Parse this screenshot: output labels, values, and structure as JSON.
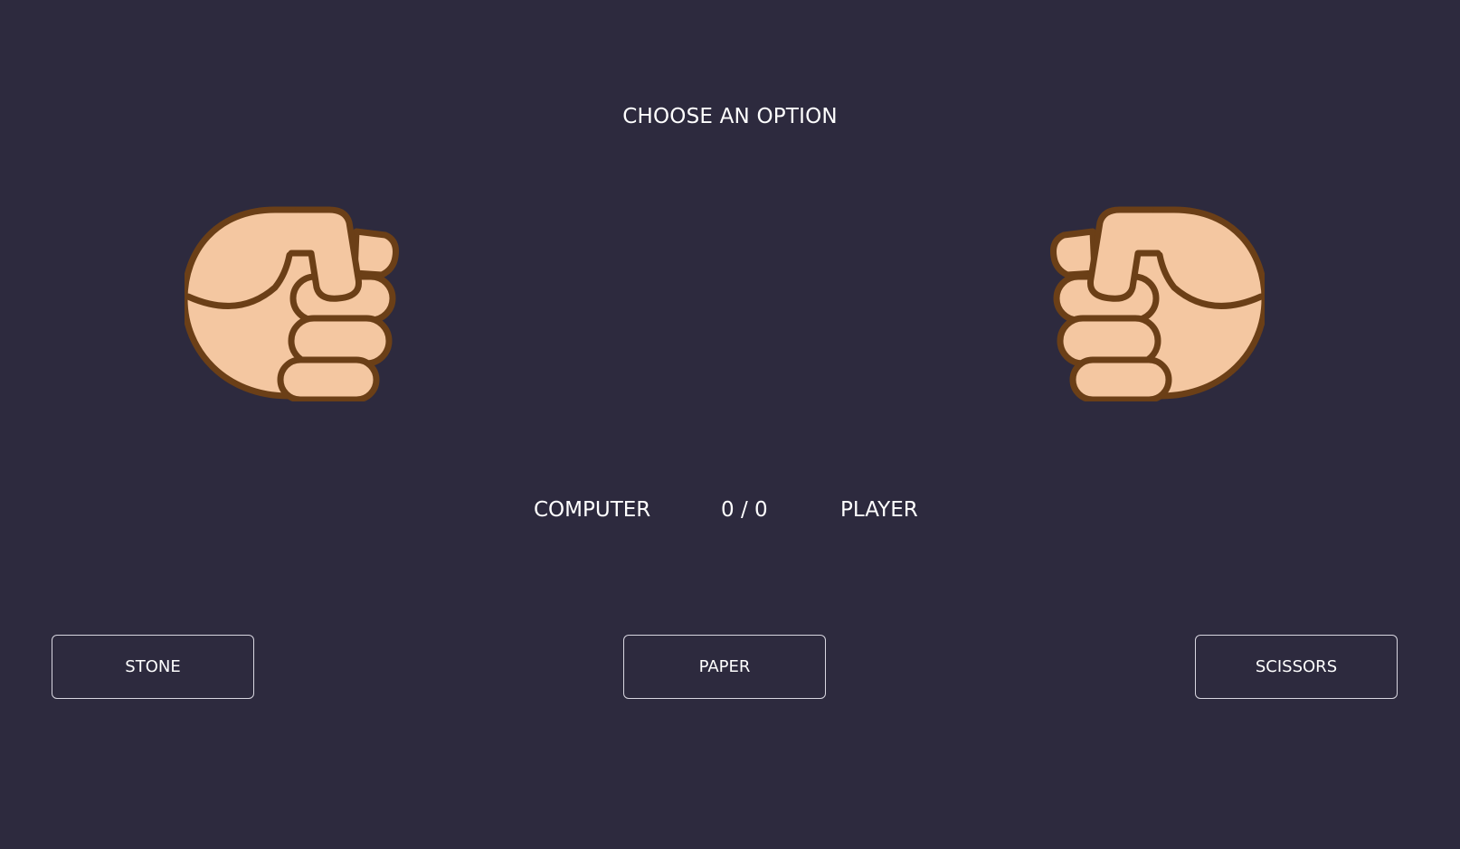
{
  "prompt": "CHOOSE AN OPTION",
  "hands": {
    "computer": {
      "icon": "fist-icon"
    },
    "player": {
      "icon": "fist-icon"
    }
  },
  "score": {
    "computer_label": "COMPUTER",
    "value": "0 / 0",
    "player_label": "PLAYER"
  },
  "choices": {
    "stone": "STONE",
    "paper": "PAPER",
    "scissors": "SCISSORS"
  },
  "colors": {
    "background": "#2d2a3e",
    "skin": "#f4c7a1",
    "outline": "#6b3f17",
    "text": "#ffffff"
  }
}
